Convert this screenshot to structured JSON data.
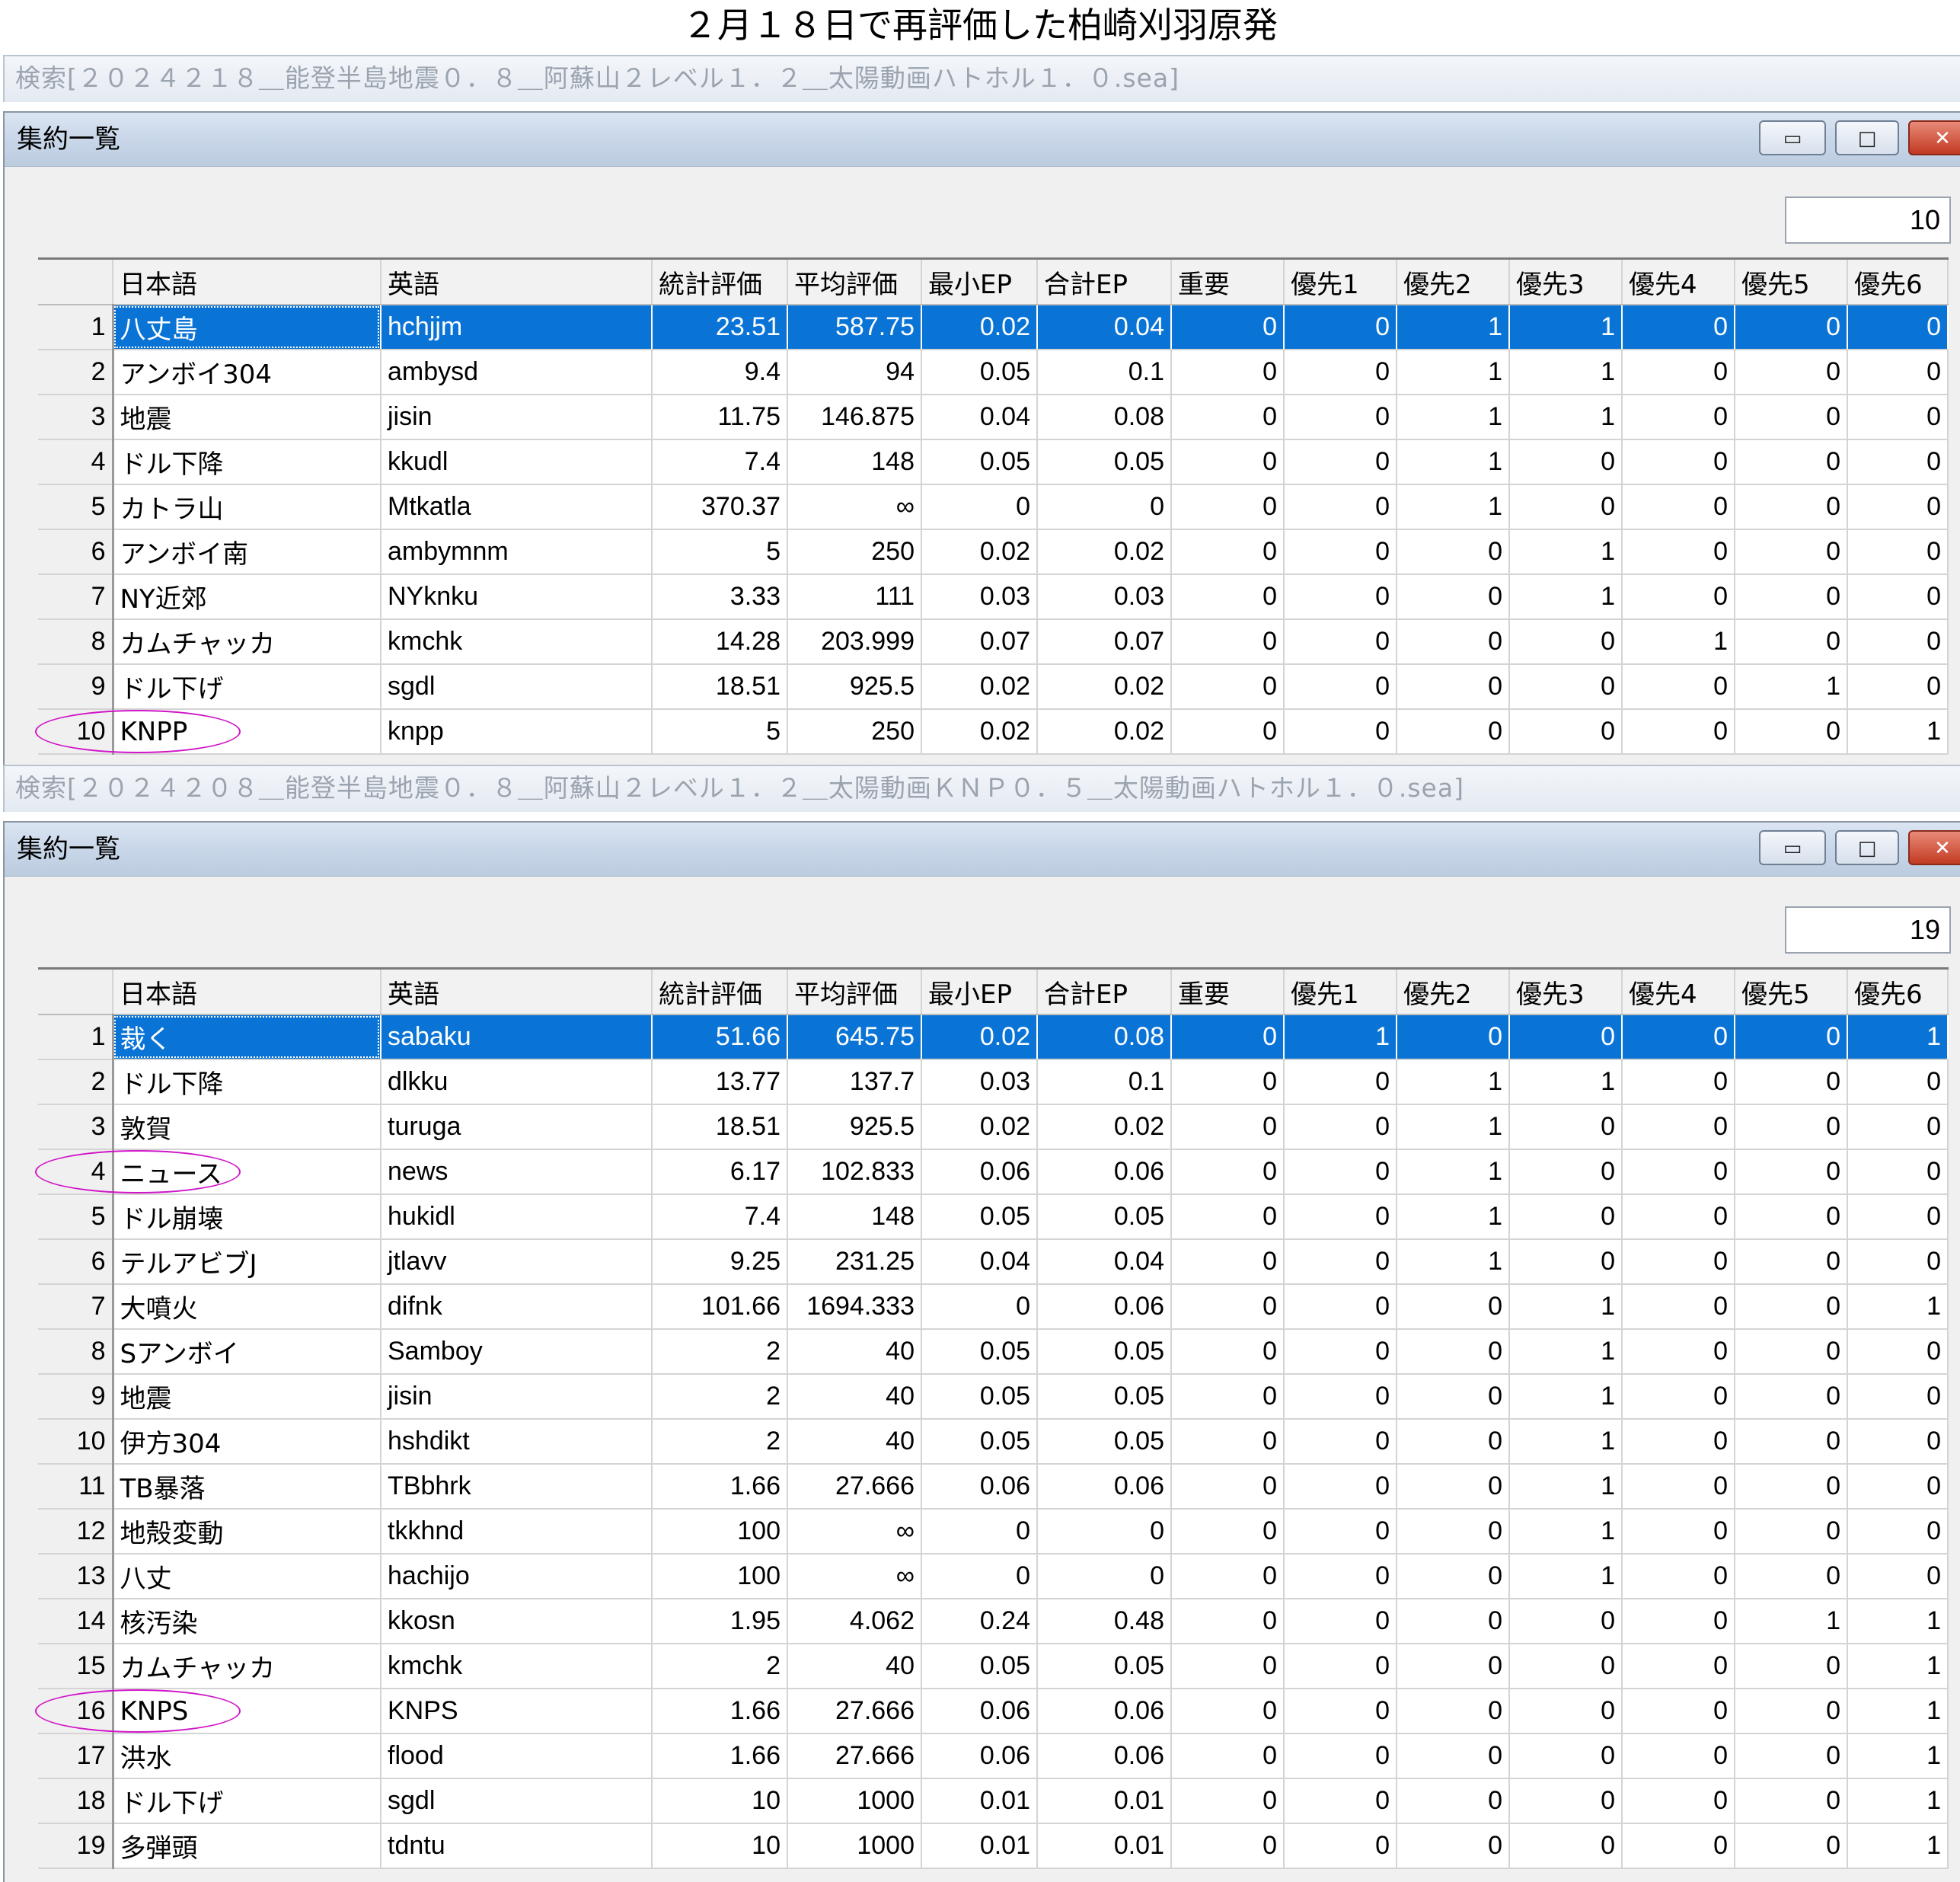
{
  "page_title": "２月１８日で再評価した柏崎刈羽原発",
  "columns": [
    "",
    "日本語",
    "英語",
    "統計評価",
    "平均評価",
    "最小EP",
    "合計EP",
    "重要",
    "優先1",
    "優先2",
    "優先3",
    "優先4",
    "優先5",
    "優先6"
  ],
  "window_controls": {
    "minimize": "▭",
    "maximize": "□",
    "close": "✕"
  },
  "panels": [
    {
      "search_title": "検索[２０２４２１８＿能登半島地震０．８＿阿蘇山２レベル１．２＿太陽動画ハトホル１．０.sea]",
      "window_title": "集約一覧",
      "count": "10",
      "selected_row": 1,
      "marked_rows": [
        10
      ],
      "rows": [
        [
          "1",
          "八丈島",
          "hchjjm",
          "23.51",
          "587.75",
          "0.02",
          "0.04",
          "0",
          "0",
          "1",
          "1",
          "0",
          "0",
          "0"
        ],
        [
          "2",
          "アンボイ304",
          "ambysd",
          "9.4",
          "94",
          "0.05",
          "0.1",
          "0",
          "0",
          "1",
          "1",
          "0",
          "0",
          "0"
        ],
        [
          "3",
          "地震",
          "jisin",
          "11.75",
          "146.875",
          "0.04",
          "0.08",
          "0",
          "0",
          "1",
          "1",
          "0",
          "0",
          "0"
        ],
        [
          "4",
          "ドル下降",
          "kkudl",
          "7.4",
          "148",
          "0.05",
          "0.05",
          "0",
          "0",
          "1",
          "0",
          "0",
          "0",
          "0"
        ],
        [
          "5",
          "カトラ山",
          "Mtkatla",
          "370.37",
          "∞",
          "0",
          "0",
          "0",
          "0",
          "1",
          "0",
          "0",
          "0",
          "0"
        ],
        [
          "6",
          "アンボイ南",
          "ambymnm",
          "5",
          "250",
          "0.02",
          "0.02",
          "0",
          "0",
          "0",
          "1",
          "0",
          "0",
          "0"
        ],
        [
          "7",
          "NY近郊",
          "NYknku",
          "3.33",
          "111",
          "0.03",
          "0.03",
          "0",
          "0",
          "0",
          "1",
          "0",
          "0",
          "0"
        ],
        [
          "8",
          "カムチャッカ",
          "kmchk",
          "14.28",
          "203.999",
          "0.07",
          "0.07",
          "0",
          "0",
          "0",
          "0",
          "1",
          "0",
          "0"
        ],
        [
          "9",
          "ドル下げ",
          "sgdl",
          "18.51",
          "925.5",
          "0.02",
          "0.02",
          "0",
          "0",
          "0",
          "0",
          "0",
          "1",
          "0"
        ],
        [
          "10",
          "KNPP",
          "knpp",
          "5",
          "250",
          "0.02",
          "0.02",
          "0",
          "0",
          "0",
          "0",
          "0",
          "0",
          "1"
        ]
      ]
    },
    {
      "search_title": "検索[２０２４２０８＿能登半島地震０．８＿阿蘇山２レベル１．２＿太陽動画ＫＮＰ０．５＿太陽動画ハトホル１．０.sea]",
      "window_title": "集約一覧",
      "count": "19",
      "selected_row": 1,
      "marked_rows": [
        4,
        16
      ],
      "rows": [
        [
          "1",
          "裁く",
          "sabaku",
          "51.66",
          "645.75",
          "0.02",
          "0.08",
          "0",
          "1",
          "0",
          "0",
          "0",
          "0",
          "1"
        ],
        [
          "2",
          "ドル下降",
          "dlkku",
          "13.77",
          "137.7",
          "0.03",
          "0.1",
          "0",
          "0",
          "1",
          "1",
          "0",
          "0",
          "0"
        ],
        [
          "3",
          "敦賀",
          "turuga",
          "18.51",
          "925.5",
          "0.02",
          "0.02",
          "0",
          "0",
          "1",
          "0",
          "0",
          "0",
          "0"
        ],
        [
          "4",
          "ニュース",
          "news",
          "6.17",
          "102.833",
          "0.06",
          "0.06",
          "0",
          "0",
          "1",
          "0",
          "0",
          "0",
          "0"
        ],
        [
          "5",
          "ドル崩壊",
          "hukidl",
          "7.4",
          "148",
          "0.05",
          "0.05",
          "0",
          "0",
          "1",
          "0",
          "0",
          "0",
          "0"
        ],
        [
          "6",
          "テルアビブJ",
          "jtlavv",
          "9.25",
          "231.25",
          "0.04",
          "0.04",
          "0",
          "0",
          "1",
          "0",
          "0",
          "0",
          "0"
        ],
        [
          "7",
          "大噴火",
          "difnk",
          "101.66",
          "1694.333",
          "0",
          "0.06",
          "0",
          "0",
          "0",
          "1",
          "0",
          "0",
          "1"
        ],
        [
          "8",
          "Sアンボイ",
          "Samboy",
          "2",
          "40",
          "0.05",
          "0.05",
          "0",
          "0",
          "0",
          "1",
          "0",
          "0",
          "0"
        ],
        [
          "9",
          "地震",
          "jisin",
          "2",
          "40",
          "0.05",
          "0.05",
          "0",
          "0",
          "0",
          "1",
          "0",
          "0",
          "0"
        ],
        [
          "10",
          "伊方304",
          "hshdikt",
          "2",
          "40",
          "0.05",
          "0.05",
          "0",
          "0",
          "0",
          "1",
          "0",
          "0",
          "0"
        ],
        [
          "11",
          "TB暴落",
          "TBbhrk",
          "1.66",
          "27.666",
          "0.06",
          "0.06",
          "0",
          "0",
          "0",
          "1",
          "0",
          "0",
          "0"
        ],
        [
          "12",
          "地殻変動",
          "tkkhnd",
          "100",
          "∞",
          "0",
          "0",
          "0",
          "0",
          "0",
          "1",
          "0",
          "0",
          "0"
        ],
        [
          "13",
          "八丈",
          "hachijo",
          "100",
          "∞",
          "0",
          "0",
          "0",
          "0",
          "0",
          "1",
          "0",
          "0",
          "0"
        ],
        [
          "14",
          "核汚染",
          "kkosn",
          "1.95",
          "4.062",
          "0.24",
          "0.48",
          "0",
          "0",
          "0",
          "0",
          "0",
          "1",
          "1"
        ],
        [
          "15",
          "カムチャッカ",
          "kmchk",
          "2",
          "40",
          "0.05",
          "0.05",
          "0",
          "0",
          "0",
          "0",
          "0",
          "0",
          "1"
        ],
        [
          "16",
          "KNPS",
          "KNPS",
          "1.66",
          "27.666",
          "0.06",
          "0.06",
          "0",
          "0",
          "0",
          "0",
          "0",
          "0",
          "1"
        ],
        [
          "17",
          "洪水",
          "flood",
          "1.66",
          "27.666",
          "0.06",
          "0.06",
          "0",
          "0",
          "0",
          "0",
          "0",
          "0",
          "1"
        ],
        [
          "18",
          "ドル下げ",
          "sgdl",
          "10",
          "1000",
          "0.01",
          "0.01",
          "0",
          "0",
          "0",
          "0",
          "0",
          "0",
          "1"
        ],
        [
          "19",
          "多弾頭",
          "tdntu",
          "10",
          "1000",
          "0.01",
          "0.01",
          "0",
          "0",
          "0",
          "0",
          "0",
          "0",
          "1"
        ]
      ]
    }
  ]
}
